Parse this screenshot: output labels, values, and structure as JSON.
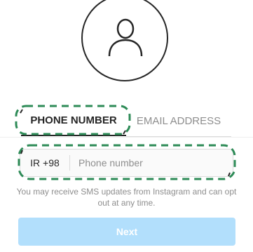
{
  "tabs": {
    "phone_label": "PHONE NUMBER",
    "email_label": "EMAIL ADDRESS",
    "selected": "phone"
  },
  "phone": {
    "country_code": "IR +98",
    "placeholder": "Phone number",
    "value": ""
  },
  "sms_note": "You may receive SMS updates from Instagram and can opt out at any time.",
  "next_label": "Next",
  "icons": {
    "avatar": "user-silhouette-icon"
  },
  "colors": {
    "text_primary": "#262626",
    "text_secondary": "#8e8e8e",
    "button_disabled": "#b2dffc",
    "highlight_annotation": "#2e8b57"
  }
}
